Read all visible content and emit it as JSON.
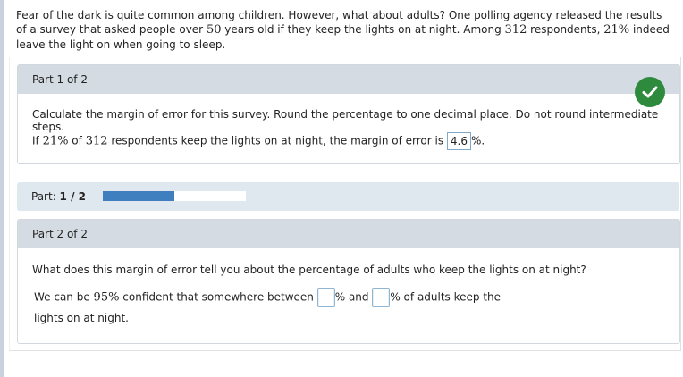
{
  "intro": {
    "text_a": "Fear of the dark is quite common among children. However, what about adults? One polling agency released the results of a survey that asked people over ",
    "age": "50",
    "text_b": " years old if they keep the lights on at night. Among ",
    "respondents": "312",
    "text_c": " respondents, ",
    "percent": "21%",
    "text_d": " indeed leave the light on when going to sleep."
  },
  "part1": {
    "header": "Part 1 of 2",
    "instruction": "Calculate the margin of error for this survey. Round the percentage to one decimal place. Do not round intermediate steps.",
    "q_if": "If ",
    "q_pct": "21%",
    "q_of": " of ",
    "q_n": "312",
    "q_rest": " respondents keep the lights on at night, the margin of error is ",
    "answer": "4.6",
    "suffix": "%.",
    "status_icon": "check-circle-icon",
    "status_color": "#2e8b3e"
  },
  "progress": {
    "label_prefix": "Part: ",
    "label_value": "1 / 2",
    "fraction": 0.5,
    "fill_color": "#3f7fbf"
  },
  "part2": {
    "header": "Part 2 of 2",
    "question": "What does this margin of error tell you about the percentage of adults who keep the lights on at night?",
    "s_a": "We can be ",
    "confidence": "95%",
    "s_b": " confident that somewhere between ",
    "mid": "% and ",
    "s_c": "% of adults keep the",
    "s_d": "lights on at night.",
    "input_low": "",
    "input_high": ""
  }
}
